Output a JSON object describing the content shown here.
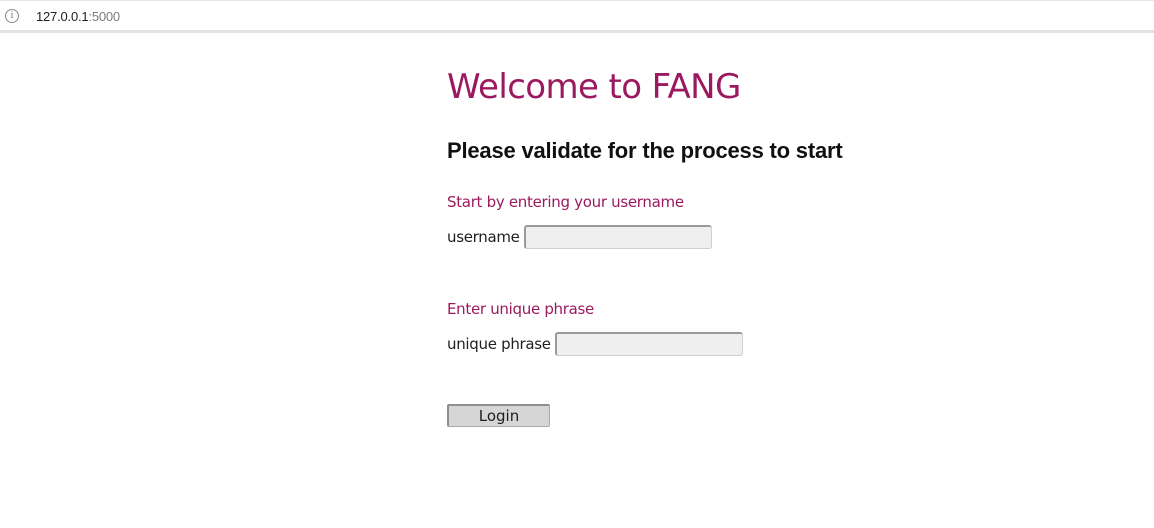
{
  "browser": {
    "url_host": "127.0.0.1",
    "url_port": ":5000",
    "info_icon": "info-icon"
  },
  "page": {
    "title": "Welcome to FANG",
    "subtitle": "Please validate for the process to start",
    "username_section_label": "Start by entering your username",
    "username_label": "username",
    "username_value": "",
    "phrase_section_label": "Enter unique phrase",
    "phrase_label": "unique phrase",
    "phrase_value": "",
    "login_label": "Login"
  },
  "colors": {
    "accent": "#9b1a5f",
    "input_background": "#efefef",
    "button_background": "#d6d6d6"
  }
}
